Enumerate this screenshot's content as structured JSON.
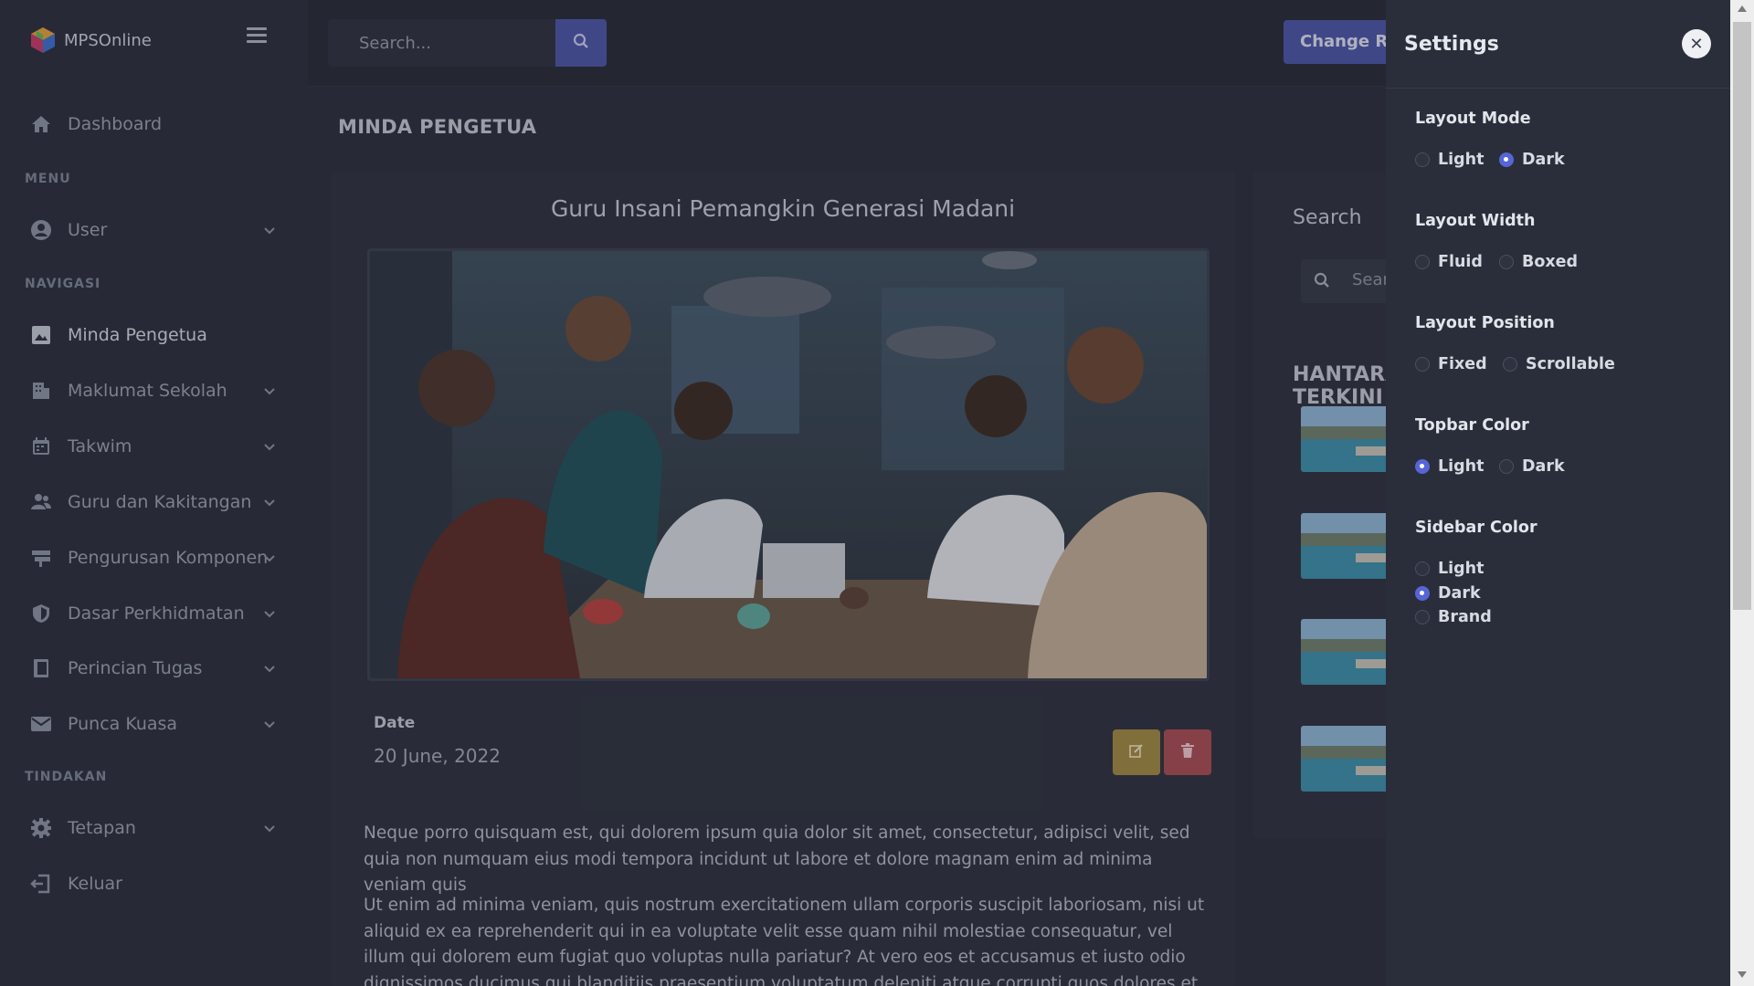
{
  "brand": {
    "name": "MPSOnline"
  },
  "topbar": {
    "search_placeholder": "Search...",
    "change_role_label": "Change Role"
  },
  "sidebar": {
    "dashboard": "Dashboard",
    "section_menu": "MENU",
    "user": "User",
    "section_navigasi": "NAVIGASI",
    "nav": [
      "Minda Pengetua",
      "Maklumat Sekolah",
      "Takwim",
      "Guru dan Kakitangan",
      "Pengurusan Komponen",
      "Dasar Perkhidmatan",
      "Perincian Tugas",
      "Punca Kuasa"
    ],
    "section_tindakan": "TINDAKAN",
    "tetapan": "Tetapan",
    "keluar": "Keluar"
  },
  "main": {
    "page_title": "MINDA PENGETUA",
    "post_title": "Guru Insani Pemangkin Generasi Madani",
    "date_label": "Date",
    "date_value": "20 June, 2022",
    "para1": "Neque porro quisquam est, qui dolorem ipsum quia dolor sit amet, consectetur, adipisci velit, sed quia non numquam eius modi tempora incidunt ut labore et dolore magnam enim ad minima veniam quis",
    "para2": "Ut enim ad minima veniam, quis nostrum exercitationem ullam corporis suscipit laboriosam, nisi ut aliquid ex ea reprehenderit qui in ea voluptate velit esse quam nihil molestiae consequatur, vel illum qui dolorem eum fugiat quo voluptas nulla pariatur? At vero eos et accusamus et iusto odio dignissimos ducimus qui blanditiis praesentium voluptatum deleniti atque corrupti quos dolores et quas molestias excepturi sint occaecati"
  },
  "right": {
    "search_title": "Search",
    "search_placeholder": "Search...",
    "hantaran_title": "HANTARAN TERKINI"
  },
  "settings": {
    "title": "Settings",
    "layout_mode": {
      "title": "Layout Mode",
      "options": [
        "Light",
        "Dark"
      ],
      "selected": "Dark"
    },
    "layout_width": {
      "title": "Layout Width",
      "options": [
        "Fluid",
        "Boxed"
      ],
      "selected": ""
    },
    "layout_position": {
      "title": "Layout Position",
      "options": [
        "Fixed",
        "Scrollable"
      ],
      "selected": ""
    },
    "topbar_color": {
      "title": "Topbar Color",
      "options": [
        "Light",
        "Dark"
      ],
      "selected": "Light"
    },
    "sidebar_color": {
      "title": "Sidebar Color",
      "options": [
        "Light",
        "Dark",
        "Brand"
      ],
      "selected": "Dark"
    }
  },
  "colors": {
    "accent": "#4b55a6",
    "edit": "#a28a41",
    "delete": "#a94b52",
    "radio_on": "#5865d6"
  }
}
